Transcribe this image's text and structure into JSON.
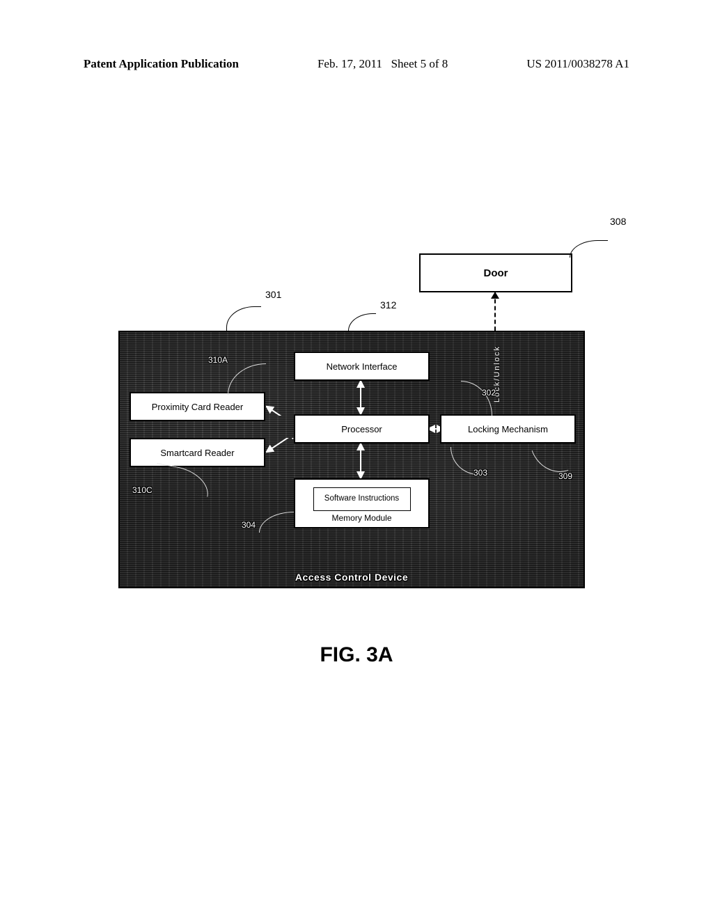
{
  "header": {
    "left": "Patent Application Publication",
    "mid_date": "Feb. 17, 2011",
    "mid_sheet": "Sheet 5 of 8",
    "right": "US 2011/0038278 A1"
  },
  "labels": {
    "r308": "308",
    "r301": "301",
    "r312": "312",
    "r310a": "310A",
    "r310c": "310C",
    "r304": "304",
    "r302": "302",
    "r303": "303",
    "r309": "309"
  },
  "boxes": {
    "door": "Door",
    "network_interface": "Network Interface",
    "proximity_reader": "Proximity Card Reader",
    "smartcard_reader": "Smartcard Reader",
    "processor": "Processor",
    "locking_mechanism": "Locking Mechanism",
    "software_instructions": "Software Instructions",
    "memory_module": "Memory Module",
    "device_label": "Access Control Device",
    "lock_unlock": "Lock/Unlock"
  },
  "figure_caption": "FIG. 3A"
}
